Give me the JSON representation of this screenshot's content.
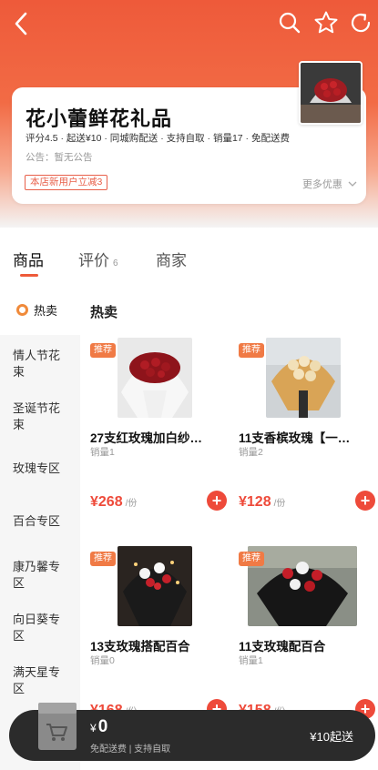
{
  "colors": {
    "accent": "#ee4a3a",
    "header": "#ee5a3a",
    "badge": "#f07a45"
  },
  "topbar": {
    "icons": [
      "back-arrow-icon",
      "search-icon",
      "star-icon",
      "share-icon"
    ]
  },
  "shop": {
    "name": "花小蕾鲜花礼品",
    "meta": "评分4.5 · 起送¥10 · 同城购配送 · 支持自取 · 销量17 · 免配送费",
    "notice": "公告：暂无公告",
    "coupon": "本店新用户立减3",
    "more": "更多优惠"
  },
  "tabs": [
    {
      "label": "商品",
      "count": ""
    },
    {
      "label": "评价",
      "count": "6"
    },
    {
      "label": "商家",
      "count": ""
    }
  ],
  "sidebar": {
    "hot": "热卖",
    "items": [
      "情人节花束",
      "圣诞节花束",
      "玫瑰专区",
      "百合专区",
      "康乃馨专区",
      "向日葵专区",
      "满天星专区"
    ]
  },
  "section_title": "热卖",
  "products": [
    {
      "badge": "推荐",
      "name": "27支红玫瑰加白纱…",
      "sales": "销量1",
      "price_symbol": "¥",
      "price": "268",
      "unit": "/份"
    },
    {
      "badge": "推荐",
      "name": "11支香槟玫瑰【一…",
      "sales": "销量2",
      "price_symbol": "¥",
      "price": "128",
      "unit": "/份"
    },
    {
      "badge": "推荐",
      "name": "13支玫瑰搭配百合",
      "sales": "销量0",
      "price_symbol": "¥",
      "price": "168",
      "unit": "/份"
    },
    {
      "badge": "推荐",
      "name": "11支玫瑰配百合",
      "sales": "销量1",
      "price_symbol": "¥",
      "price": "158",
      "unit": "/份"
    }
  ],
  "cart": {
    "currency": "¥",
    "amount": "0",
    "sub": "免配送费 | 支持自取",
    "min_order": "¥10起送"
  }
}
